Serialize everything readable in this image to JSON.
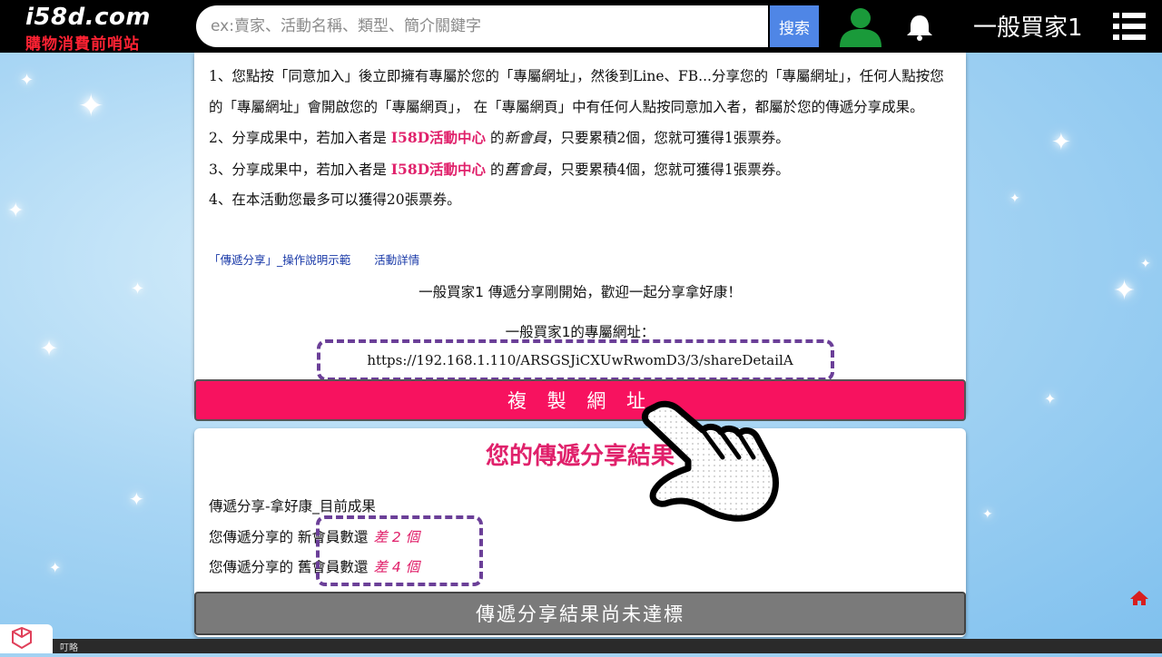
{
  "header": {
    "logo_main": "i58d.com",
    "logo_sub": "購物消費前哨站",
    "search_placeholder": "ex:賣家、活動名稱、類型、簡介關鍵字",
    "search_button": "搜索",
    "username": "一般買家1",
    "icons": [
      "user-icon",
      "bell-icon",
      "menu-icon"
    ]
  },
  "rules": {
    "rule1": "1、您點按「同意加入」後立即擁有專屬於您的「專屬網址」，然後到Line、FB...分享您的「專屬網址」，任何人點按您的「專屬網址」會開啟您的「專屬網頁」，  在「專屬網頁」中有任何人點按同意加入者，都屬於您的傳遞分享成果。",
    "rule2_a": "2、分享成果中，若加入者是 ",
    "rule2_center": "I58D活動中心",
    "rule2_b": " 的",
    "rule2_member": "新會員",
    "rule2_c": "，只要累積2個，您就可獲得1張票券。",
    "rule3_a": "3、分享成果中，若加入者是 ",
    "rule3_center": "I58D活動中心",
    "rule3_b": " 的",
    "rule3_member": "舊會員",
    "rule3_c": "，只要累積4個，您就可獲得1張票券。",
    "rule4": "4、在本活動您最多可以獲得20張票券。"
  },
  "links": {
    "demo": "「傳遞分享」_操作說明示範",
    "details": "活動詳情"
  },
  "share": {
    "welcome": "一般買家1 傳遞分享剛開始，歡迎一起分享拿好康！",
    "url_label": "一般買家1的專屬網址：",
    "url": "https://192.168.1.110/ARSGSJiCXUwRwomD3/3/shareDetailA",
    "copy_button": "複 製 網 址"
  },
  "results": {
    "title": "您的傳遞分享結果",
    "subtitle": "傳遞分享-拿好康_目前成果",
    "new_label": "您傳遞分享的 新會員數還",
    "new_shortage": "差 2 個",
    "old_label": "您傳遞分享的 舊會員數還",
    "old_shortage": "差 4 個",
    "status_button": "傳遞分享結果尚未達標"
  },
  "footer": {
    "text": "叮略"
  },
  "colors": {
    "accent_pink": "#f7125f",
    "highlight_red": "#e0216b",
    "search_blue": "#4f86e6",
    "dash_purple": "#6b3f98",
    "user_green": "#1a9a3a"
  }
}
